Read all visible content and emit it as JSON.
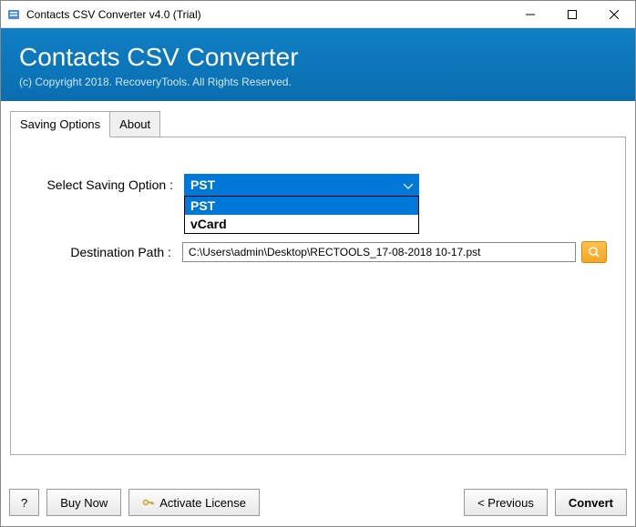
{
  "window": {
    "title": "Contacts CSV Converter v4.0 (Trial)"
  },
  "banner": {
    "title": "Contacts CSV Converter",
    "copyright": "(c) Copyright 2018. RecoveryTools. All Rights Reserved."
  },
  "tabs": {
    "saving": "Saving Options",
    "about": "About"
  },
  "form": {
    "select_label": "Select Saving Option :",
    "select_value": "PST",
    "options": {
      "opt1": "PST",
      "opt2": "vCard"
    },
    "dest_label": "Destination Path :",
    "dest_value": "C:\\Users\\admin\\Desktop\\RECTOOLS_17-08-2018 10-17.pst"
  },
  "footer": {
    "help": "?",
    "buy": "Buy Now",
    "activate": "Activate License",
    "previous": "<  Previous",
    "convert": "Convert"
  }
}
